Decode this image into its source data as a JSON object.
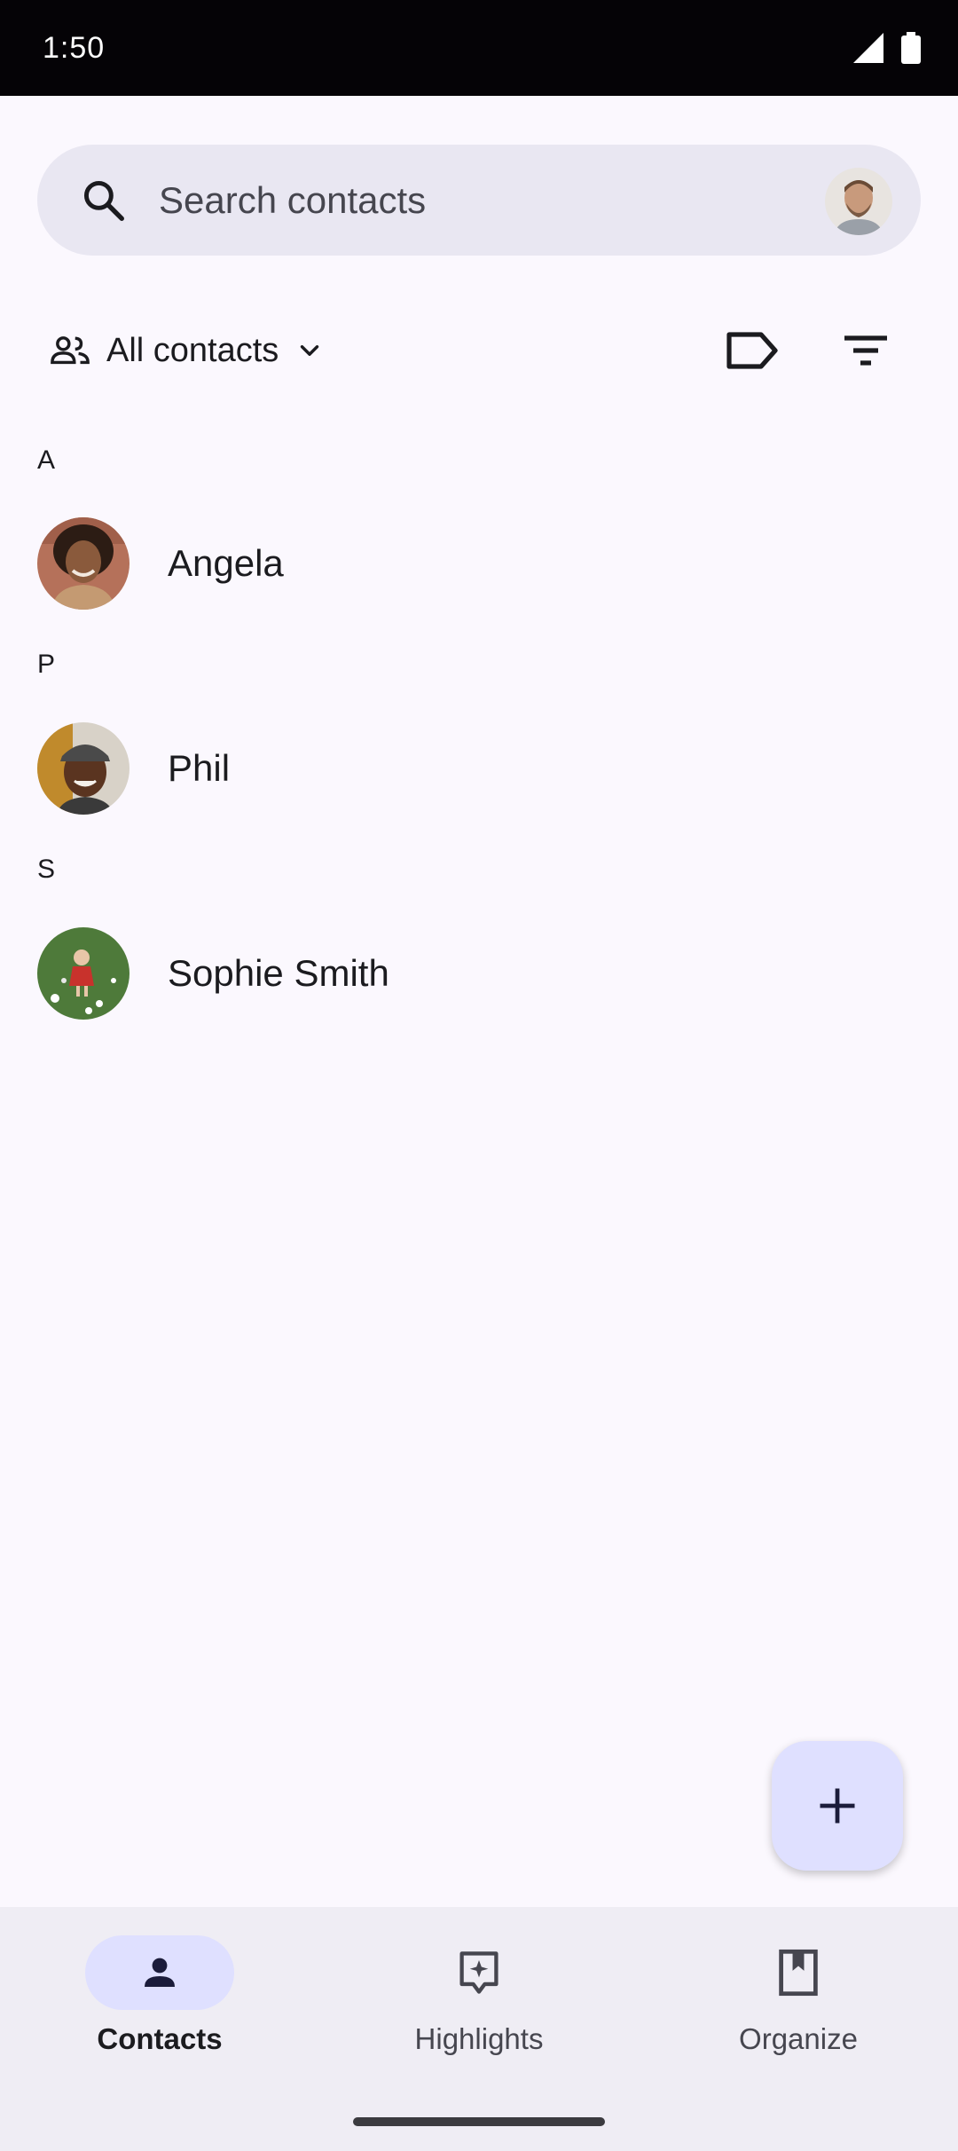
{
  "status_bar": {
    "time": "1:50",
    "icons": [
      "signal-icon",
      "battery-icon"
    ]
  },
  "search": {
    "placeholder": "Search contacts",
    "account_avatar": "account-avatar"
  },
  "filter": {
    "label": "All contacts",
    "icons": [
      "people-icon",
      "chevron-down-icon",
      "label-icon",
      "sort-icon"
    ]
  },
  "sections": [
    {
      "letter": "A",
      "contacts": [
        {
          "name": "Angela"
        }
      ]
    },
    {
      "letter": "P",
      "contacts": [
        {
          "name": "Phil"
        }
      ]
    },
    {
      "letter": "S",
      "contacts": [
        {
          "name": "Sophie Smith"
        }
      ]
    }
  ],
  "fab": {
    "icon": "plus-icon"
  },
  "bottom_nav": {
    "items": [
      {
        "label": "Contacts",
        "icon": "person-icon",
        "active": true
      },
      {
        "label": "Highlights",
        "icon": "highlights-icon",
        "active": false
      },
      {
        "label": "Organize",
        "icon": "bookmark-icon",
        "active": false
      }
    ]
  },
  "colors": {
    "accent_container": "#dfe0ff",
    "surface": "#fbf8fe",
    "search_bg": "#e9e7f2",
    "nav_bg": "#efedf4"
  }
}
